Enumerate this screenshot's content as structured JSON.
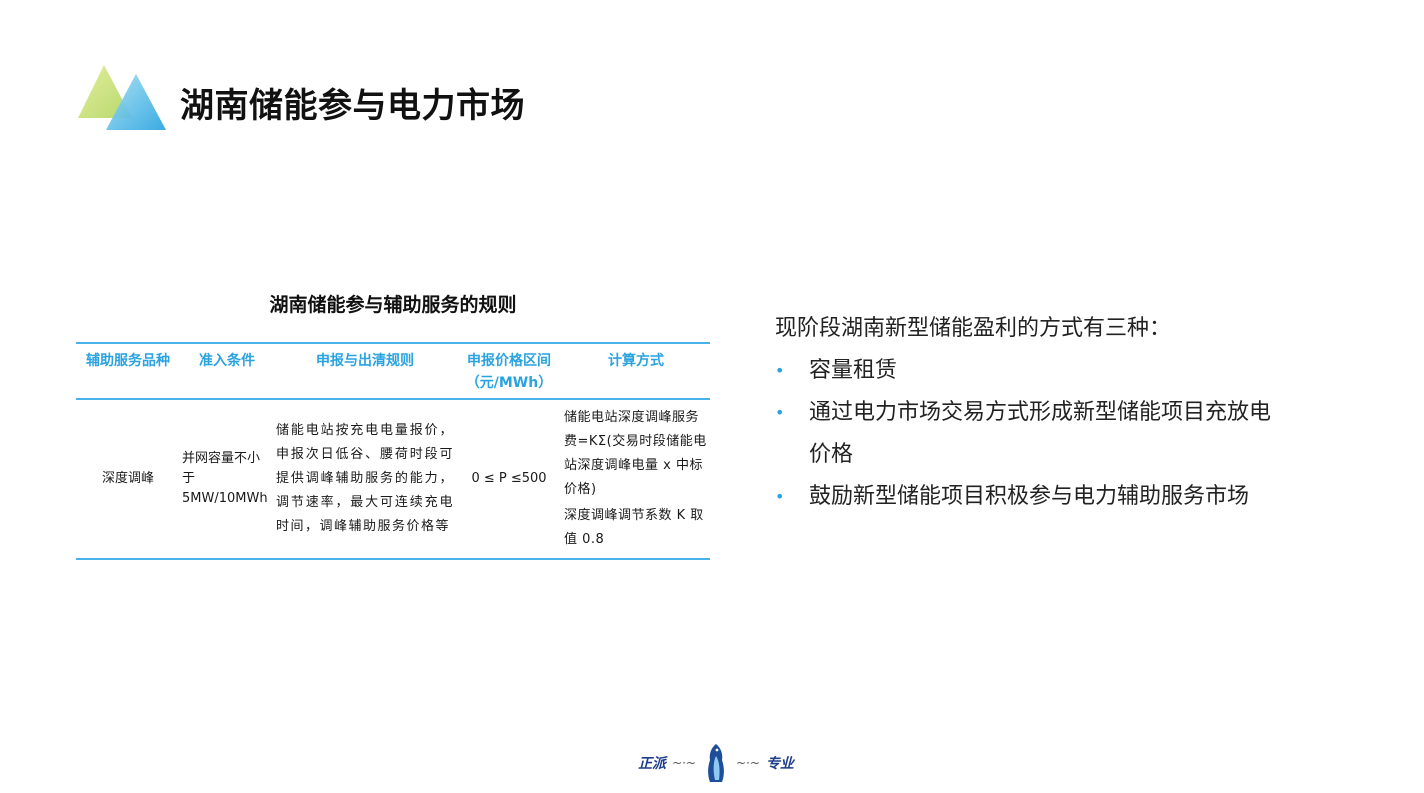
{
  "title": "湖南储能参与电力市场",
  "table": {
    "caption": "湖南储能参与辅助服务的规则",
    "headers": {
      "type": "辅助服务品种",
      "condition": "准入条件",
      "rules": "申报与出清规则",
      "range_line1": "申报价格区间",
      "range_line2": "（元/MWh）",
      "calc": "计算方式"
    },
    "row": {
      "type": "深度调峰",
      "condition": "并网容量不小于5MW/10MWh",
      "rules": "储能电站按充电电量报价，申报次日低谷、腰荷时段可提供调峰辅助服务的能力，调节速率，最大可连续充电时间，调峰辅助服务价格等",
      "range": "0 ≤ P ≤500",
      "calc_line1": "储能电站深度调峰服务费=KΣ(交易时段储能电站深度调峰电量 x 中标价格)",
      "calc_line2": "深度调峰调节系数 K 取值 0.8"
    }
  },
  "right": {
    "intro": "现阶段湖南新型储能盈利的方式有三种：",
    "bullets": [
      "容量租赁",
      "通过电力市场交易方式形成新型储能项目充放电价格",
      "鼓励新型储能项目积极参与电力辅助服务市场"
    ]
  },
  "footer": {
    "left": "正派",
    "right": "专业"
  },
  "colors": {
    "accent": "#2aa3e0",
    "rule": "#48b3ea",
    "logo_green": "#c8e07a",
    "logo_blue": "#3ab0e6"
  }
}
